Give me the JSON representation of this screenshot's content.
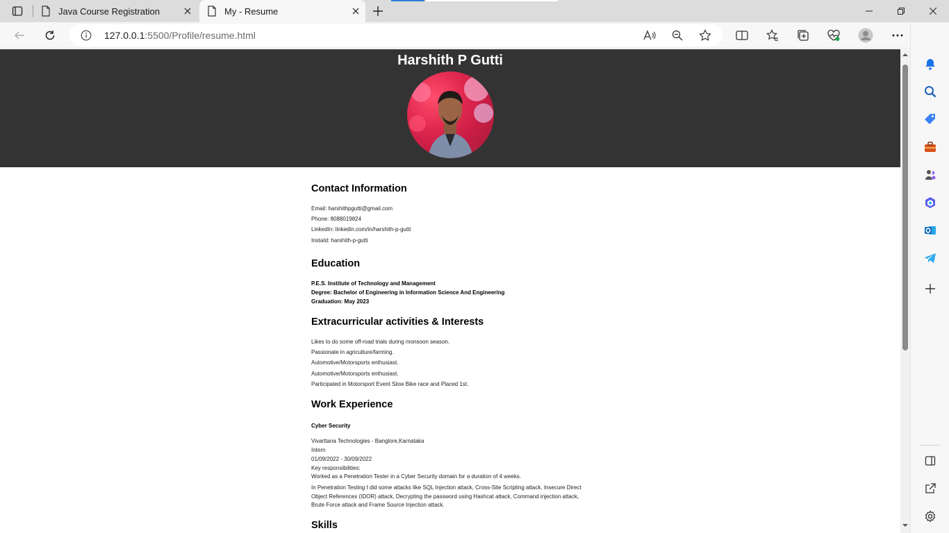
{
  "browser": {
    "tabs": [
      {
        "title": "Java Course Registration"
      },
      {
        "title": "My - Resume"
      }
    ],
    "address": {
      "url_host": "127.0.0.1",
      "url_rest": ":5500/Profile/resume.html"
    },
    "toolbar_icons": [
      "back-icon",
      "refresh-icon",
      "info-icon",
      "read-aloud-icon",
      "zoom-out-icon",
      "favorite-star-icon",
      "split-screen-icon",
      "favorites-icon",
      "collections-icon",
      "browser-essentials-icon",
      "profile-icon",
      "more-icon",
      "bing-chat-icon"
    ],
    "sidebar_icons": [
      "notifications-icon",
      "search-icon",
      "shopping-icon",
      "tools-icon",
      "games-icon",
      "office-icon",
      "outlook-icon",
      "telegram-icon",
      "add-icon",
      "sidebar-toggle-icon",
      "open-external-icon",
      "settings-icon"
    ]
  },
  "resume": {
    "name": "Harshith P Gutti",
    "contact": {
      "heading": "Contact Information",
      "email": "Email: harshithpgutti@gmail.com",
      "phone": "Phone: 8088019824",
      "linkedin": "LinkedIn: linkedin.com/in/harshith-p-gutti",
      "instaid": "InstaId: harshith-p-gutti"
    },
    "education": {
      "heading": "Education",
      "institute": "P.E.S. Institute of Technology and Management",
      "degree": "Degree: Bachelor of Engineering in Information Science And Engineering",
      "graduation": "Graduation: May 2023"
    },
    "extracurricular": {
      "heading": "Extracurricular activities & Interests",
      "items": [
        "Likes to do some off-road trials during monsoon season.",
        "Passionate in agriculture/farming.",
        "Automotive/Motorsports enthusiast.",
        "Automotive/Motorsports enthusiast.",
        "Participated in Motorsport Event Slow Bike race and Placed 1st."
      ]
    },
    "work": {
      "heading": "Work Experience",
      "role_title": "Cyber Security",
      "company": "Vivarttana Technologies - Banglore,Karnataka",
      "position": "Intern",
      "dates": "01/09/2022 - 30/09/2022",
      "key_label": "Key responsibilities:",
      "resp1": "Worked as a Penetration Tester in a Cyber Security domain for a duration of 4 weeks.",
      "resp2": "In Penetration Testing I did some attacks like SQL Injection attack, Cross-Site Scripting attack, Insecure Direct Object References (IDOR) attack, Decrypting the password using Hashcat attack, Command injection attack, Brute Force attack and Frame Source Injection attack."
    },
    "skills": {
      "heading": "Skills"
    }
  },
  "colors": {
    "header_bg": "#333333",
    "header_text": "#ffffff",
    "tabstrip_bg": "#dcdcdc",
    "toolbar_bg": "#f7f7f7",
    "accent": "#2b7fd6"
  }
}
